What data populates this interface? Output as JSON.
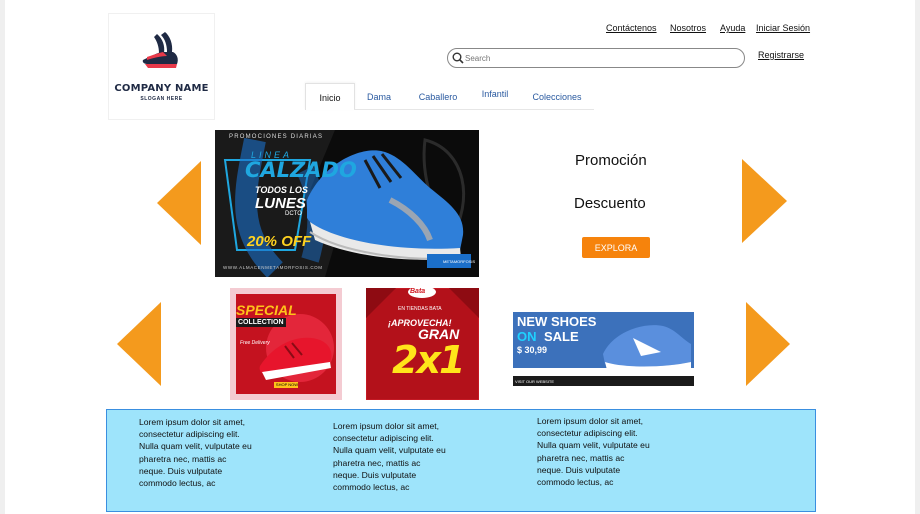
{
  "logo": {
    "company_name": "COMPANY NAME",
    "slogan": "SLOGAN HERE",
    "icon": "shoe-icon"
  },
  "header": {
    "links": [
      "Contáctenos",
      "Nosotros",
      "Ayuda",
      "Iniciar Sesión"
    ],
    "register": "Registrarse"
  },
  "search": {
    "placeholder": "Search",
    "icon": "search-icon"
  },
  "tabs": [
    {
      "label": "Inicio",
      "active": true
    },
    {
      "label": "Dama"
    },
    {
      "label": "Caballero"
    },
    {
      "label": "Infantil"
    },
    {
      "label": "Colecciones"
    }
  ],
  "hero": {
    "banner": {
      "top": "PROMOCIONES DIARIAS",
      "linea": "LINEA",
      "calzado": "CALZADO",
      "todos": "TODOS LOS",
      "lunes": "LUNES",
      "dcto": "DCTO",
      "percent": "20% OFF",
      "url": "WWW.ALMACENMETAMORFOSIS.COM",
      "brand": "METAMORFOSIS"
    },
    "promo_title": "Promoción",
    "promo_subtitle": "Descuento",
    "cta": "EXPLORA"
  },
  "cards": {
    "special": {
      "line1": "SPECIAL",
      "line2": "COLLECTION",
      "script": "Free Delivery",
      "button": "SHOP NOW"
    },
    "bata": {
      "brand": "Bata",
      "line1": "EN TIENDAS BATA",
      "line2": "¡APROVECHA!",
      "line3": "GRAN",
      "line4": "2x1"
    },
    "newshoes": {
      "line1": "NEW SHOES",
      "on": "ON",
      "sale": "SALE",
      "price": "$ 30,99",
      "footer": "VISIT OUR WEBSITE"
    }
  },
  "footer": {
    "columns": [
      "Lorem ipsum dolor sit amet, consectetur adipiscing elit. Nulla quam velit, vulputate eu pharetra nec, mattis ac neque. Duis vulputate commodo lectus, ac",
      "Lorem ipsum dolor sit amet, consectetur adipiscing elit. Nulla quam velit, vulputate eu pharetra nec, mattis ac neque. Duis vulputate commodo lectus, ac",
      "Lorem ipsum dolor sit amet, consectetur adipiscing elit. Nulla quam velit, vulputate eu pharetra nec, mattis ac neque. Duis vulputate commodo lectus, ac"
    ]
  },
  "colors": {
    "accent": "#f49a1d",
    "cta": "#f6830c",
    "footer_bg": "#9ee4fb"
  }
}
